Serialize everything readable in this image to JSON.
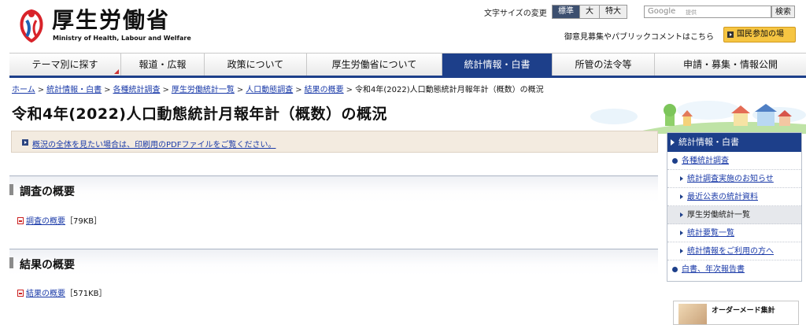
{
  "header": {
    "logo_title": "厚生労働省",
    "logo_sub": "Ministry of Health, Labour and Welfare",
    "font_size_label": "文字サイズの変更",
    "font_sizes": [
      "標準",
      "大",
      "特大"
    ],
    "search_placeholder": "Google",
    "search_sub": "提供",
    "search_button": "検索",
    "opinion_link": "御意見募集やパブリックコメントはこちら",
    "participate_button": "国民参加の場"
  },
  "nav": {
    "items": [
      {
        "label": "テーマ別に探す"
      },
      {
        "label": "報道・広報"
      },
      {
        "label": "政策について"
      },
      {
        "label": "厚生労働省について"
      },
      {
        "label": "統計情報・白書"
      },
      {
        "label": "所管の法令等"
      },
      {
        "label": "申請・募集・情報公開"
      }
    ],
    "active": "統計情報・白書"
  },
  "breadcrumb": {
    "items": [
      "ホーム",
      "統計情報・白書",
      "各種統計調査",
      "厚生労働統計一覧",
      "人口動態調査",
      "結果の概要"
    ],
    "current": "令和4年(2022)人口動態統計月報年計（概数）の概況"
  },
  "page_title": "令和4年(2022)人口動態統計月報年計（概数）の概況",
  "notice": "概況の全体を見たい場合は、印刷用のPDFファイルをご覧ください。",
  "sections": [
    {
      "heading": "調査の概要",
      "file_label": "調査の概要",
      "file_size": "［79KB］"
    },
    {
      "heading": "結果の概要",
      "file_label": "結果の概要",
      "file_size": "［571KB］"
    }
  ],
  "sidebar": {
    "title": "統計情報・白書",
    "items": [
      {
        "label": "各種統計調査",
        "level": 1
      },
      {
        "label": "統計調査実施のお知らせ",
        "level": 2
      },
      {
        "label": "最近公表の統計資料",
        "level": 2
      },
      {
        "label": "厚生労働統計一覧",
        "level": 2
      },
      {
        "label": "統計要覧一覧",
        "level": 2
      },
      {
        "label": "統計情報をご利用の方へ",
        "level": 2
      },
      {
        "label": "白書、年次報告書",
        "level": 1
      }
    ]
  },
  "banner": "オーダーメード集計",
  "colors": {
    "nav_active": "#1d3f8a",
    "link": "#1a3aa8",
    "notice_bg": "#f3ebe0"
  }
}
